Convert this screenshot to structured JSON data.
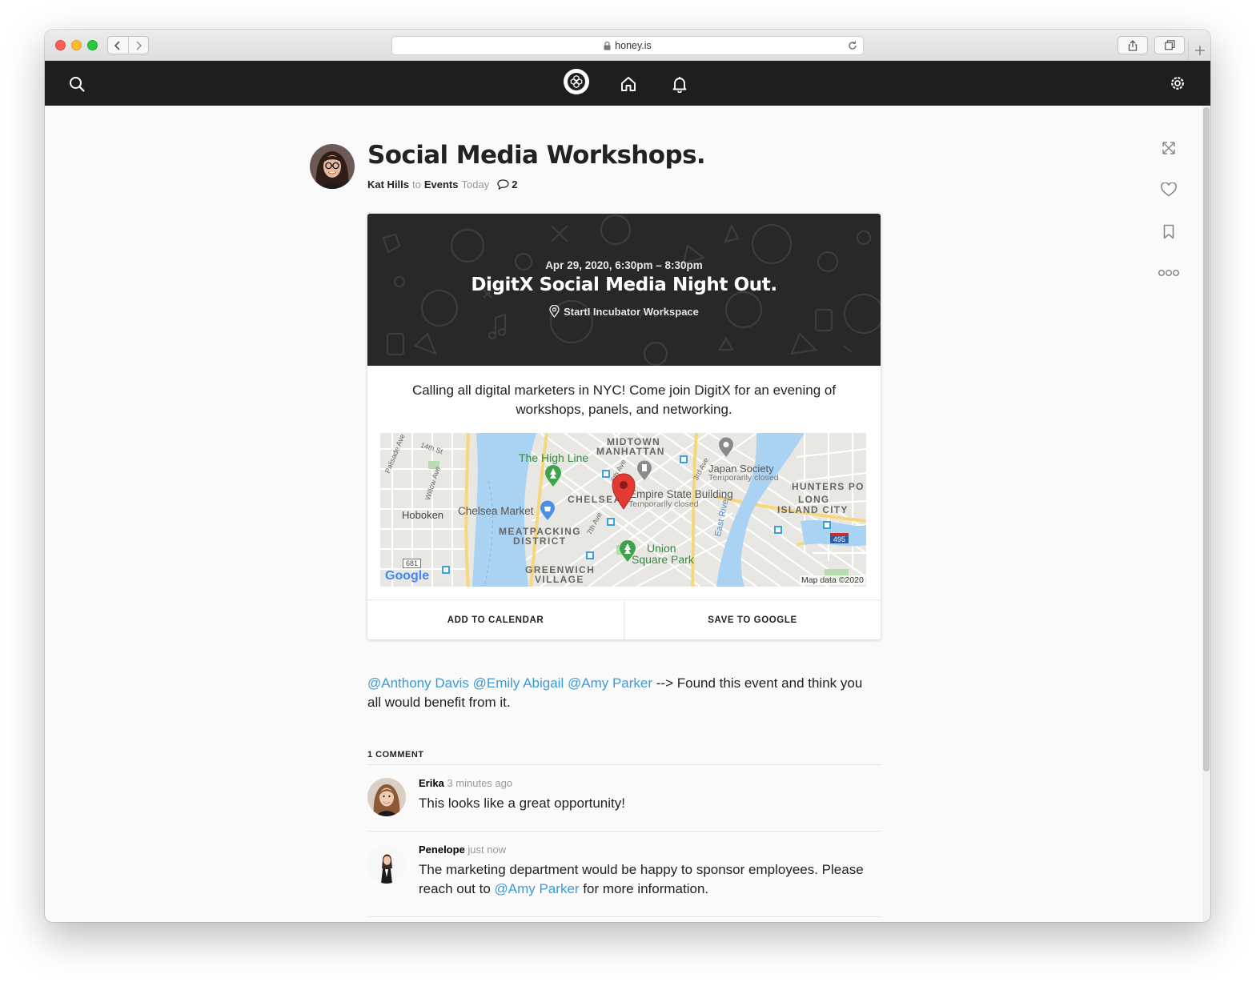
{
  "browser": {
    "url": "honey.is"
  },
  "post": {
    "title": "Social Media Workshops.",
    "author": "Kat Hills",
    "to_word": "to",
    "channel": "Events",
    "time": "Today",
    "comment_count": "2"
  },
  "event": {
    "date": "Apr 29, 2020, 6:30pm – 8:30pm",
    "title": "DigitX Social Media Night Out.",
    "location": "StartI Incubator Workspace",
    "description": "Calling all digital marketers in NYC! Come join DigitX for an evening of workshops, panels, and networking.",
    "add_calendar": "ADD TO CALENDAR",
    "save_google": "SAVE TO GOOGLE"
  },
  "map": {
    "labels": {
      "midtown": "MIDTOWN",
      "manhattan": "MANHATTAN",
      "high_line": "The High Line",
      "japan_society": "Japan Society",
      "temporarily_closed": "Temporarily closed",
      "hunters": "HUNTERS PO",
      "long": "LONG",
      "island_city": "ISLAND CITY",
      "chelsea": "CHELSEA",
      "esb": "Empire State Building",
      "esb_closed": "Temporarily closed",
      "hoboken": "Hoboken",
      "chelsea_market": "Chelsea Market",
      "meatpacking": "MEATPACKING",
      "district": "DISTRICT",
      "union_square": "Union",
      "square_park": "Square Park",
      "east_river": "East River",
      "greenwich": "GREENWICH",
      "village": "VILLAGE",
      "st14": "14th St",
      "palisade": "Palisade Ave",
      "willow": "Willow Ave",
      "seventh": "7th Ave",
      "sixth": "6th Ave",
      "third": "3rd Ave",
      "route681": "681",
      "i495": "495",
      "google": "Google",
      "map_data": "Map data ©2020"
    }
  },
  "body": {
    "mentions": [
      "@Anthony Davis",
      "@Emily Abigail",
      "@Amy Parker"
    ],
    "text": " --> Found this event and think you all would benefit from it."
  },
  "comments": {
    "header": "1 COMMENT",
    "items": [
      {
        "author": "Erika",
        "time": "3 minutes ago",
        "text": "This looks like a great opportunity!"
      },
      {
        "author": "Penelope",
        "time": "just now",
        "text_before": "The marketing department would be happy to sponsor employees. Please reach out to ",
        "mention": "@Amy Parker",
        "text_after": " for more information."
      }
    ]
  },
  "colors": {
    "appbar": "#1e1e1e",
    "mention": "#3b9bd6",
    "banner": "#282828"
  }
}
